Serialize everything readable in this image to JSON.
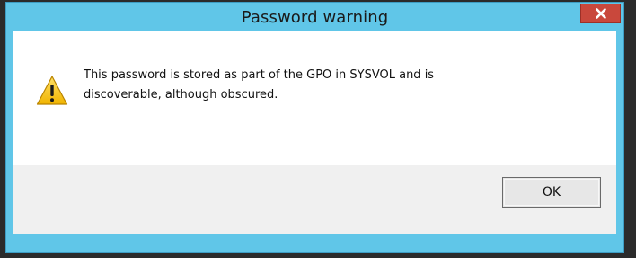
{
  "dialog": {
    "title": "Password warning",
    "close_label": "x",
    "message_line1": "This password is stored as part of the GPO in SYSVOL and is",
    "message_line2": "discoverable, although obscured.",
    "icon": "warning-icon",
    "ok_label": "OK"
  },
  "colors": {
    "titlebar": "#60c6e8",
    "close_button": "#c9483c",
    "body": "#ffffff",
    "footer": "#f0f0f0",
    "warning_yellow": "#f5c518"
  }
}
